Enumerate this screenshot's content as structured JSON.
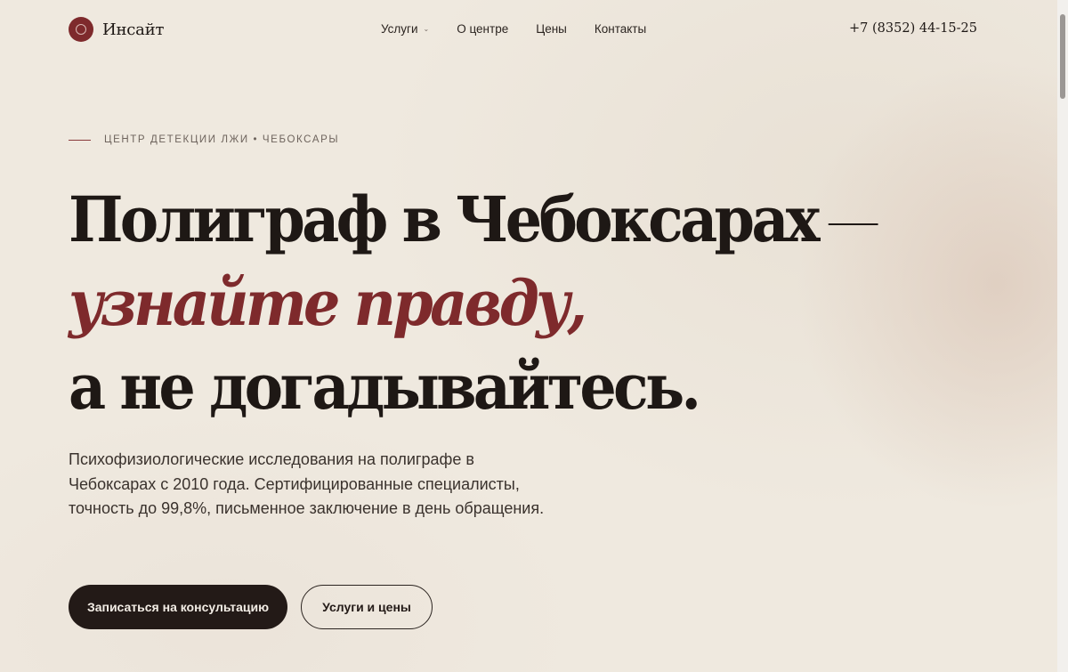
{
  "header": {
    "logo_text": "Инсайт",
    "nav": [
      {
        "label": "Услуги",
        "has_dropdown": true
      },
      {
        "label": "О центре",
        "has_dropdown": false
      },
      {
        "label": "Цены",
        "has_dropdown": false
      },
      {
        "label": "Контакты",
        "has_dropdown": false
      }
    ],
    "phone": "+7 (8352) 44-15-25"
  },
  "hero": {
    "eyebrow": "Центр детекции лжи • Чебоксары",
    "headline_line1": "Полиграф в Чебоксарах",
    "headline_line2": "узнайте правду,",
    "headline_line3": "а не догадывайтесь.",
    "lead": "Психофизиологические исследования на полиграфе в Чебоксарах с 2010 года. Сертифицированные специалисты, точность до 99,8%, письменное заключение в день обращения.",
    "cta_primary": "Записаться на консультацию",
    "cta_secondary": "Услуги и цены"
  },
  "icons": {
    "chevron": "chevron-down-icon"
  },
  "colors": {
    "accent": "#7e2a2c",
    "dark": "#231a17",
    "background": "#efe9df"
  }
}
